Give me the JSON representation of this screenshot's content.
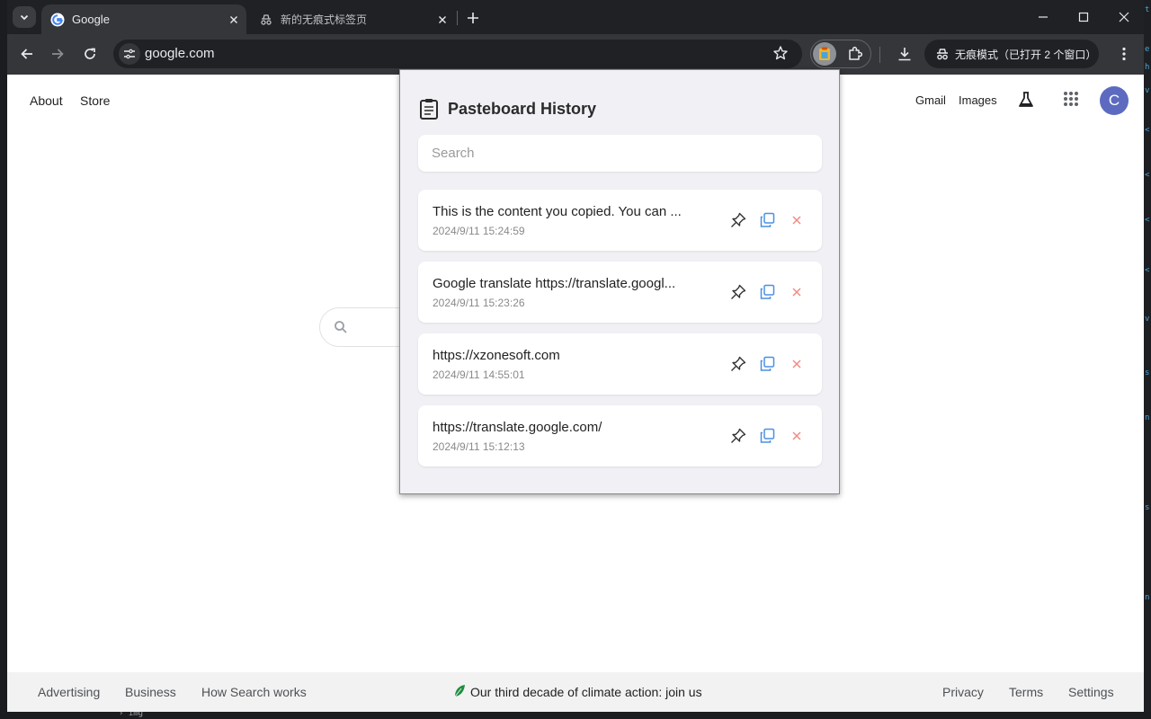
{
  "browser": {
    "tabs": [
      {
        "title": "Google",
        "active": true
      },
      {
        "title": "新的无痕式标签页",
        "active": false
      }
    ],
    "address": "google.com",
    "incognito_label": "无痕模式（已打开 2 个窗口）"
  },
  "google": {
    "top_left_links": [
      "About",
      "Store"
    ],
    "top_right_links": [
      "Gmail",
      "Images"
    ],
    "avatar_letter": "C",
    "footer_left": [
      "Advertising",
      "Business",
      "How Search works"
    ],
    "footer_center": "Our third decade of climate action: join us",
    "footer_right": [
      "Privacy",
      "Terms",
      "Settings"
    ]
  },
  "popup": {
    "title": "Pasteboard History",
    "search_placeholder": "Search",
    "items": [
      {
        "content": "This is the content you copied. You can ...",
        "time": "2024/9/11 15:24:59"
      },
      {
        "content": "Google translate https://translate.googl...",
        "time": "2024/9/11 15:23:26"
      },
      {
        "content": "https://xzonesoft.com",
        "time": "2024/9/11 14:55:01"
      },
      {
        "content": "https://translate.google.com/",
        "time": "2024/9/11 15:12:13"
      }
    ]
  },
  "background_ide": {
    "bottom_text": "› img"
  },
  "colors": {
    "copy_icon": "#4a90e2",
    "delete_icon": "#f28b82",
    "avatar": "#5c6bc0",
    "chrome_toolbar": "#35363a",
    "chrome_tabstrip": "#202124"
  }
}
